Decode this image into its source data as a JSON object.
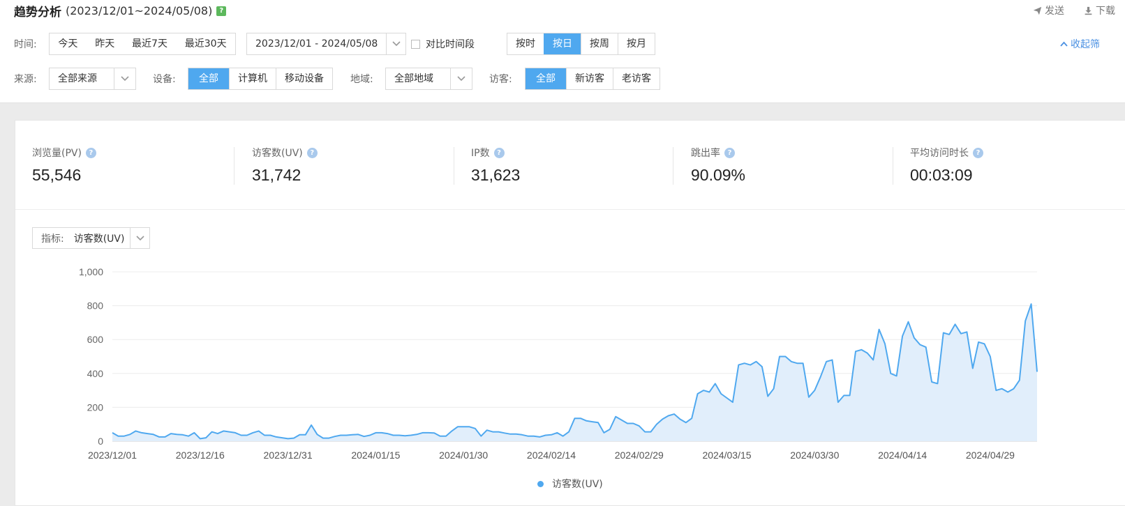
{
  "header": {
    "title": "趋势分析",
    "date_range": "(2023/12/01~2024/05/08)",
    "help": "?",
    "send_label": "发送",
    "download_label": "下载"
  },
  "filters": {
    "time_label": "时间:",
    "time_quick": [
      "今天",
      "昨天",
      "最近7天",
      "最近30天"
    ],
    "date_input": "2023/12/01 - 2024/05/08",
    "compare_label": "对比时间段",
    "granularity": [
      "按时",
      "按日",
      "按周",
      "按月"
    ],
    "granularity_active": "按日",
    "collapse_label": "收起筛",
    "source_label": "来源:",
    "source_value": "全部来源",
    "device_label": "设备:",
    "device_options": [
      "全部",
      "计算机",
      "移动设备"
    ],
    "device_active": "全部",
    "region_label": "地域:",
    "region_value": "全部地域",
    "visitor_label": "访客:",
    "visitor_options": [
      "全部",
      "新访客",
      "老访客"
    ],
    "visitor_active": "全部"
  },
  "metrics": [
    {
      "label": "浏览量(PV)",
      "value": "55,546"
    },
    {
      "label": "访客数(UV)",
      "value": "31,742"
    },
    {
      "label": "IP数",
      "value": "31,623"
    },
    {
      "label": "跳出率",
      "value": "90.09%"
    },
    {
      "label": "平均访问时长",
      "value": "00:03:09"
    }
  ],
  "indicator": {
    "label": "指标:",
    "value": "访客数(UV)"
  },
  "chart_data": {
    "type": "area",
    "ylim": [
      0,
      1000
    ],
    "yticks": [
      "0",
      "200",
      "400",
      "600",
      "800",
      "1,000"
    ],
    "x_tick_labels": [
      "2023/12/01",
      "2023/12/16",
      "2023/12/31",
      "2024/01/15",
      "2024/01/30",
      "2024/02/14",
      "2024/02/29",
      "2024/03/15",
      "2024/03/30",
      "2024/04/14",
      "2024/04/29"
    ],
    "grid": true,
    "legend_position": "bottom-center",
    "series": [
      {
        "name": "访客数(UV)",
        "color": "#4fa8ef",
        "values": [
          50,
          30,
          30,
          40,
          60,
          50,
          45,
          40,
          25,
          25,
          45,
          40,
          38,
          30,
          50,
          15,
          20,
          55,
          45,
          60,
          55,
          50,
          35,
          35,
          50,
          60,
          35,
          35,
          25,
          20,
          15,
          18,
          38,
          38,
          95,
          40,
          18,
          18,
          28,
          35,
          35,
          38,
          40,
          28,
          35,
          50,
          50,
          45,
          35,
          35,
          32,
          35,
          40,
          50,
          50,
          48,
          30,
          30,
          60,
          85,
          85,
          85,
          75,
          30,
          65,
          55,
          55,
          48,
          42,
          42,
          38,
          30,
          30,
          25,
          35,
          38,
          50,
          30,
          55,
          135,
          135,
          120,
          115,
          110,
          50,
          70,
          145,
          125,
          105,
          105,
          90,
          55,
          55,
          100,
          130,
          150,
          160,
          130,
          110,
          135,
          280,
          300,
          290,
          340,
          280,
          255,
          230,
          450,
          460,
          450,
          470,
          440,
          265,
          310,
          500,
          500,
          470,
          460,
          460,
          260,
          300,
          380,
          470,
          480,
          230,
          270,
          270,
          530,
          540,
          520,
          480,
          660,
          575,
          400,
          385,
          620,
          705,
          610,
          570,
          555,
          350,
          340,
          640,
          630,
          690,
          635,
          645,
          430,
          585,
          575,
          500,
          300,
          310,
          290,
          310,
          360,
          710,
          810,
          410
        ]
      }
    ]
  }
}
